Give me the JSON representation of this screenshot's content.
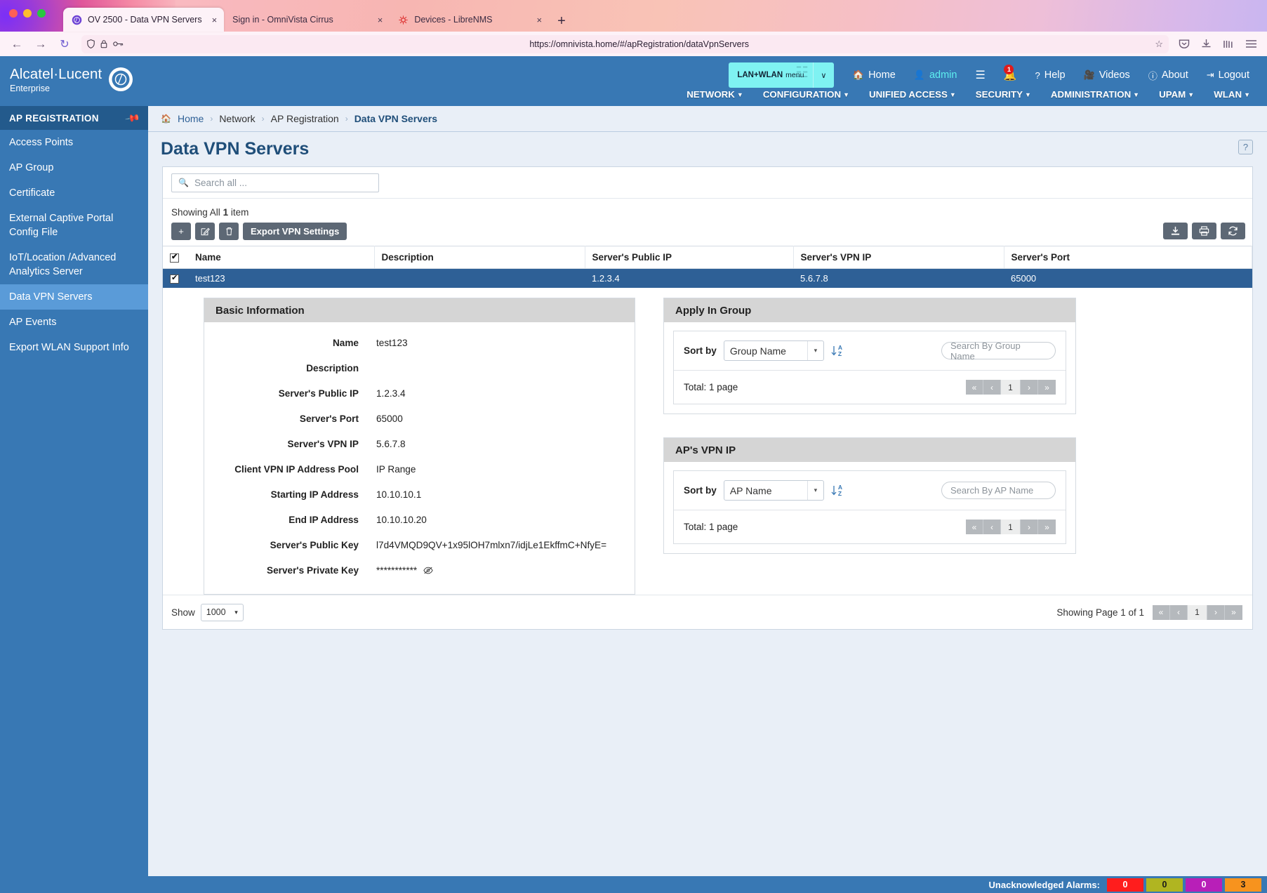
{
  "browser": {
    "tabs": [
      {
        "title": "OV 2500 - Data VPN Servers",
        "active": true,
        "favicon": "omnivista-icon"
      },
      {
        "title": "Sign in - OmniVista Cirrus",
        "active": false,
        "favicon": "none"
      },
      {
        "title": "Devices - LibreNMS",
        "active": false,
        "favicon": "librenms-icon"
      }
    ],
    "new_tab_label": "+",
    "close_label": "×",
    "back_icon": "←",
    "forward_icon": "→",
    "reload_icon": "↻",
    "url": "https://omnivista.home/#/apRegistration/dataVpnServers",
    "shield_icon": "shield-icon",
    "lock_icon": "lock-icon",
    "key_icon": "key-icon",
    "bookmark_icon": "☆",
    "right_icons": [
      "pocket-icon",
      "downloads-icon",
      "library-icon",
      "menu-icon"
    ]
  },
  "header": {
    "brand": "Alcatel·Lucent",
    "brand_sub": "Enterprise",
    "context_selector": {
      "main": "LAN+WLAN",
      "sub": "menu",
      "arrow": "∨"
    },
    "actions": [
      {
        "label": "Home",
        "icon": "home-icon",
        "accent": false
      },
      {
        "label": "admin",
        "icon": "user-icon",
        "accent": true
      },
      {
        "label": "",
        "icon": "list-icon",
        "accent": false
      },
      {
        "label": "",
        "icon": "bell-icon",
        "accent": false,
        "badge": "1"
      },
      {
        "label": "Help",
        "icon": "question-icon",
        "accent": false
      },
      {
        "label": "Videos",
        "icon": "video-icon",
        "accent": false
      },
      {
        "label": "About",
        "icon": "info-icon",
        "accent": false
      },
      {
        "label": "Logout",
        "icon": "logout-icon",
        "accent": false
      }
    ],
    "nav": [
      {
        "label": "NETWORK"
      },
      {
        "label": "CONFIGURATION"
      },
      {
        "label": "UNIFIED ACCESS"
      },
      {
        "label": "SECURITY"
      },
      {
        "label": "ADMINISTRATION"
      },
      {
        "label": "UPAM"
      },
      {
        "label": "WLAN"
      }
    ]
  },
  "sidebar": {
    "title": "AP REGISTRATION",
    "pin_icon": "pin-icon",
    "items": [
      {
        "label": "Access Points",
        "active": false
      },
      {
        "label": "AP Group",
        "active": false
      },
      {
        "label": "Certificate",
        "active": false
      },
      {
        "label": "External Captive Portal Config File",
        "active": false
      },
      {
        "label": "IoT/Location /Advanced Analytics Server",
        "active": false
      },
      {
        "label": "Data VPN Servers",
        "active": true
      },
      {
        "label": "AP Events",
        "active": false
      },
      {
        "label": "Export WLAN Support Info",
        "active": false
      }
    ]
  },
  "breadcrumb": {
    "home_icon": "home-icon",
    "separator": "›",
    "items": [
      "Home",
      "Network",
      "AP Registration",
      "Data VPN Servers"
    ]
  },
  "page": {
    "title": "Data VPN Servers",
    "help_icon": "?"
  },
  "search": {
    "placeholder": "Search all ...",
    "icon": "search-icon"
  },
  "toolbar": {
    "showing_prefix": "Showing All",
    "showing_count": "1",
    "showing_suffix": "item",
    "add_icon": "+",
    "edit_icon": "edit-icon",
    "delete_icon": "trash-icon",
    "export_label": "Export VPN Settings",
    "download_icon": "download-icon",
    "print_icon": "print-icon",
    "refresh_icon": "refresh-icon"
  },
  "table": {
    "columns": [
      "Name",
      "Description",
      "Server's Public IP",
      "Server's VPN IP",
      "Server's Port"
    ],
    "rows": [
      {
        "selected": true,
        "name": "test123",
        "description": "",
        "public_ip": "1.2.3.4",
        "vpn_ip": "5.6.7.8",
        "port": "65000"
      }
    ]
  },
  "basic_information": {
    "title": "Basic Information",
    "fields": [
      {
        "label": "Name",
        "value": "test123"
      },
      {
        "label": "Description",
        "value": ""
      },
      {
        "label": "Server's Public IP",
        "value": "1.2.3.4"
      },
      {
        "label": "Server's Port",
        "value": "65000"
      },
      {
        "label": "Server's VPN IP",
        "value": "5.6.7.8"
      },
      {
        "label": "Client VPN IP Address Pool",
        "value": "IP Range"
      },
      {
        "label": "Starting IP Address",
        "value": "10.10.10.1"
      },
      {
        "label": "End IP Address",
        "value": "10.10.10.20"
      },
      {
        "label": "Server's Public Key",
        "value": "l7d4VMQD9QV+1x95lOH7mlxn7/idjLe1EkffmC+NfyE="
      },
      {
        "label": "Server's Private Key",
        "value": "***********",
        "eye_icon": "eye-slash-icon"
      }
    ]
  },
  "apply_in_group": {
    "title": "Apply In Group",
    "sort_label": "Sort by",
    "sort_value": "Group Name",
    "sort_arrow": "▾",
    "sort_dir_icon": "sort-az-icon",
    "search_placeholder": "Search By Group Name",
    "total_text": "Total: 1 page",
    "pager": {
      "first": "«",
      "prev": "‹",
      "current": "1",
      "next": "›",
      "last": "»"
    }
  },
  "aps_vpn_ip": {
    "title": "AP's VPN IP",
    "sort_label": "Sort by",
    "sort_value": "AP Name",
    "sort_arrow": "▾",
    "sort_dir_icon": "sort-az-icon",
    "search_placeholder": "Search By AP Name",
    "total_text": "Total: 1 page",
    "pager": {
      "first": "«",
      "prev": "‹",
      "current": "1",
      "next": "›",
      "last": "»"
    }
  },
  "footer": {
    "show_label": "Show",
    "page_size": "1000",
    "page_size_arrow": "▾",
    "showing_page": "Showing Page 1 of 1",
    "pager": {
      "first": "«",
      "prev": "‹",
      "current": "1",
      "next": "›",
      "last": "»"
    }
  },
  "statusbar": {
    "label": "Unacknowledged Alarms:",
    "alarms": [
      {
        "count": "0",
        "color": "#ff1d1d",
        "text_color": "#ffffff"
      },
      {
        "count": "0",
        "color": "#b0b521",
        "text_color": "#1a1a1a"
      },
      {
        "count": "0",
        "color": "#b81fb8",
        "text_color": "#ffffff"
      },
      {
        "count": "3",
        "color": "#f7931e",
        "text_color": "#1a1a1a"
      }
    ]
  },
  "colors": {
    "header_blue": "#3878b4",
    "sidebar_active": "#5a9bd8",
    "row_selected": "#2e6096",
    "accent_cyan": "#5ef0f0",
    "title_blue": "#1f4e79"
  }
}
